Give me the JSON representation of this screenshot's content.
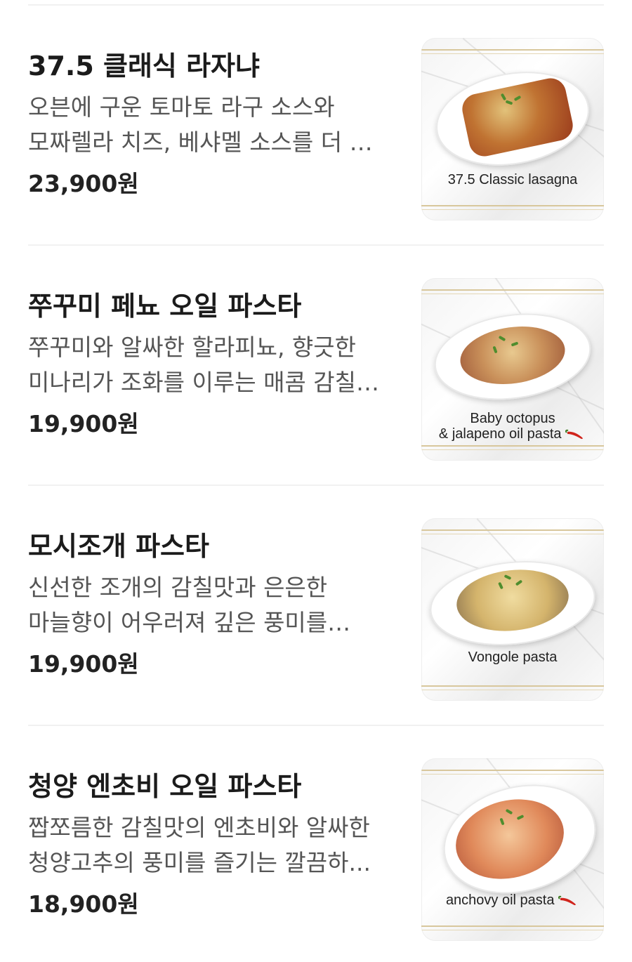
{
  "menu": {
    "items": [
      {
        "name": "37.5 클래식 라자냐",
        "description": "오븐에 구운 토마토 라구 소스와 모짜렐라 치즈, 베샤멜 소스를 더 한 클...",
        "price": "23,900원",
        "image": {
          "caption_line1": "37.5 Classic lasagna",
          "caption_line2": "",
          "spicy_icon": "",
          "food_color": "#b5552a"
        }
      },
      {
        "name": "쭈꾸미 페뇨 오일 파스타",
        "description": "쭈꾸미와 알싸한 할라피뇨, 향긋한 미나리가 조화를 이루는 매콤 감칠맛 ...",
        "price": "19,900원",
        "image": {
          "caption_line1": "Baby octopus",
          "caption_line2": "& jalapeno oil pasta",
          "spicy_icon": "chili-pepper-icon",
          "food_color": "#c9a06a"
        }
      },
      {
        "name": "모시조개 파스타",
        "description": "신선한 조개의 감칠맛과 은은한 마늘향이 어우러져 깊은 풍미를 담아낸 ...",
        "price": "19,900원",
        "image": {
          "caption_line1": "Vongole pasta",
          "caption_line2": "",
          "spicy_icon": "",
          "food_color": "#d9bf7d"
        }
      },
      {
        "name": "청양 엔초비 오일 파스타",
        "description": "짭쪼름한 감칠맛의 엔초비와 알싸한 청양고추의 풍미를 즐기는 깔끔하...",
        "price": "18,900원",
        "image": {
          "caption_line1": "anchovy oil pasta",
          "caption_line2": "",
          "spicy_icon": "chili-pepper-icon",
          "food_color": "#d98a5a"
        }
      }
    ]
  },
  "colors": {
    "accent_gold": "#d8c79c",
    "chili_red": "#d0241c",
    "text_dark": "#1b1b1b",
    "text_muted": "#555555"
  }
}
